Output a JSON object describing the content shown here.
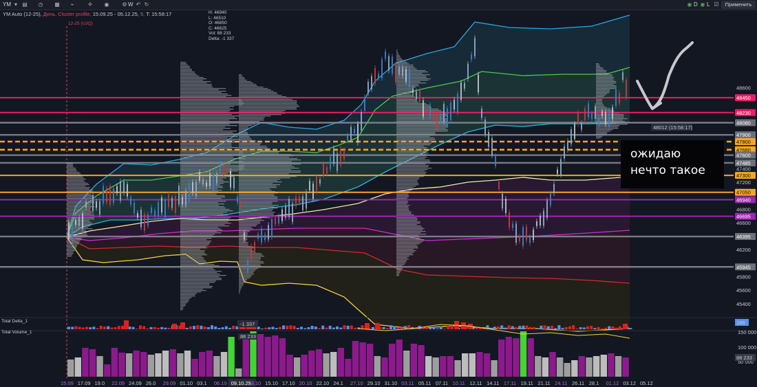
{
  "toolbar": {
    "symbol": "YM",
    "apply_label": "Применить",
    "indicator_d": "D",
    "indicator_l": "L",
    "w_label": "W"
  },
  "info": {
    "title": "YM Auto (12-25),",
    "period": "День,",
    "type": "Cluster profile,",
    "range": "15.09.25 - 05.12.25,",
    "tf": "5,",
    "time": "T: 15:58:17"
  },
  "ohlc": {
    "h": "H: 46940",
    "l": "L: 46510",
    "o": "O: 46850",
    "c": "C: 46625",
    "vol": "Vol: 88 233",
    "delta": "Delta: -1 337"
  },
  "session_label": "12-25 (UJQ)",
  "overlay": {
    "line1": "ожидаю",
    "line2": "нечто такое"
  },
  "price_label": "48012 (15:58:17)",
  "panes": {
    "delta": "Total Delta_1",
    "volume": "Total Volume_1"
  },
  "chart_data": [
    {
      "type": "line",
      "pane": "price",
      "y_ticks": [
        48600,
        48400,
        48200,
        48000,
        47800,
        47600,
        47400,
        47200,
        47000,
        46800,
        46600,
        46400,
        46200,
        46000,
        45800,
        45600,
        45400
      ],
      "levels": [
        {
          "value": 48450,
          "color": "#e91e63",
          "style": "solid"
        },
        {
          "value": 48230,
          "color": "#e91e63",
          "style": "solid"
        },
        {
          "value": 48080,
          "color": "#8a8d96",
          "style": "solid"
        },
        {
          "value": 47900,
          "color": "#8a8d96",
          "style": "solid"
        },
        {
          "value": 47800,
          "color": "#f5a623",
          "style": "dashed"
        },
        {
          "value": 47680,
          "color": "#f5a623",
          "style": "dashed"
        },
        {
          "value": 47600,
          "color": "#8a8d96",
          "style": "solid"
        },
        {
          "value": 47485,
          "color": "#8a8d96",
          "style": "solid"
        },
        {
          "value": 47300,
          "color": "#f5a623",
          "style": "solid"
        },
        {
          "value": 47050,
          "color": "#f5a623",
          "style": "solid"
        },
        {
          "value": 46940,
          "color": "#9c27b0",
          "style": "solid"
        },
        {
          "value": 46695,
          "color": "#9c27b0",
          "style": "solid"
        },
        {
          "value": 46395,
          "color": "#8a8d96",
          "style": "solid"
        },
        {
          "value": 45945,
          "color": "#8a8d96",
          "style": "solid"
        }
      ],
      "last_price": 48012,
      "price_range": [
        45400,
        48700
      ]
    },
    {
      "type": "bar",
      "pane": "delta",
      "label": "Total Delta_1",
      "annotation": "-1 337",
      "right_value": "199"
    },
    {
      "type": "bar",
      "pane": "volume",
      "label": "Total Volume_1",
      "annotation": "88 233",
      "y_ticks": [
        "150 000",
        "100 000",
        "50 000"
      ],
      "x_labels": [
        "15.09",
        "17.09",
        "19.0",
        "22.09",
        "24.09",
        "26.0",
        "29.09",
        "01.10",
        "03.1",
        "06.10",
        "09.10.25",
        "13.10",
        "15.10",
        "17.10",
        "20.10",
        "22.10",
        "24.1",
        "27.10",
        "29.10",
        "31.10",
        "03.11",
        "05.11",
        "07.11",
        "10.11",
        "12.11",
        "14.11",
        "17.11",
        "19.11",
        "21.11",
        "24.11",
        "26.11",
        "28.1",
        "01.12",
        "03.12",
        "05.12"
      ],
      "highlighted_x_labels": [
        "15.09",
        "22.09",
        "29.09",
        "06.10",
        "13.10",
        "20.10",
        "27.10",
        "03.11",
        "10.11",
        "17.11",
        "24.11",
        "01.12"
      ],
      "right_value": "88 233"
    }
  ]
}
